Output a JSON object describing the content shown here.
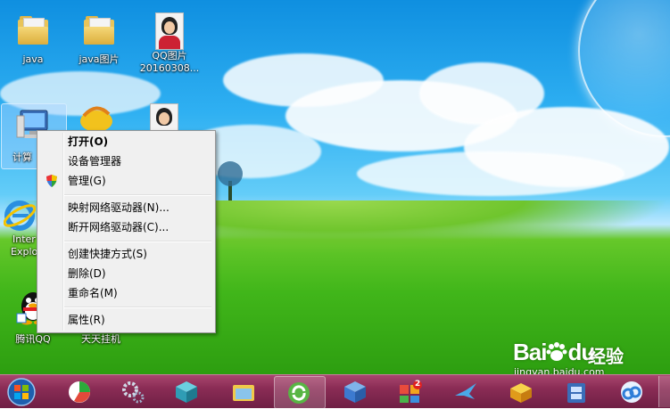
{
  "desktop": {
    "icons": [
      {
        "label": "java"
      },
      {
        "label": "java图片"
      },
      {
        "label": "QQ图片20160308..."
      },
      {
        "label": "计算机"
      },
      {
        "label": "Internet Explorer"
      },
      {
        "label": "腾讯QQ"
      },
      {
        "label": "天天挂机"
      }
    ],
    "ie_label_line1": "Inter",
    "ie_label_line2": "Explo",
    "computer_label_visible": "计算",
    "qq_photo_line1": "QQ图片",
    "qq_photo_line2": "20160308..."
  },
  "context_menu": {
    "items": [
      {
        "label": "打开(O)",
        "bold": true
      },
      {
        "label": "设备管理器"
      },
      {
        "label": "管理(G)",
        "icon": "uac-shield-icon"
      },
      {
        "label": "映射网络驱动器(N)..."
      },
      {
        "label": "断开网络驱动器(C)..."
      },
      {
        "label": "创建快捷方式(S)"
      },
      {
        "label": "删除(D)"
      },
      {
        "label": "重命名(M)"
      },
      {
        "label": "属性(R)"
      }
    ]
  },
  "taskbar": {
    "apps": [
      {
        "name": "start-orb-icon"
      },
      {
        "name": "app-360-browser-icon"
      },
      {
        "name": "settings-gears-icon"
      },
      {
        "name": "cube-grid-app-icon"
      },
      {
        "name": "file-explorer-icon"
      },
      {
        "name": "refresh-sync-app-icon"
      },
      {
        "name": "blue-box-app-icon"
      },
      {
        "name": "app-store-icon",
        "badge": "2"
      },
      {
        "name": "bird-app-icon"
      },
      {
        "name": "yellow-box-app-icon"
      },
      {
        "name": "film-app-icon"
      },
      {
        "name": "cloud-app-icon"
      }
    ]
  },
  "watermark": {
    "brand": "Bai",
    "brand2": "du",
    "sub": "经验",
    "url": "jingyan.baidu.com"
  },
  "colors": {
    "taskbar": "#8a2c55",
    "menu_bg": "#f0f0f0",
    "sky": "#2fb0f2",
    "grass": "#41b61a"
  }
}
